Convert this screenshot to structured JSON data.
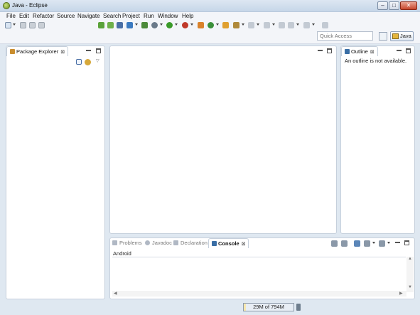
{
  "window": {
    "title": "Java - Eclipse",
    "controls": [
      "–",
      "□",
      "✕"
    ]
  },
  "menu": [
    "File",
    "Edit",
    "Refactor",
    "Source",
    "Navigate",
    "Search",
    "Project",
    "Run",
    "Window",
    "Help"
  ],
  "quick_access": {
    "placeholder": "Quick Access"
  },
  "perspective": {
    "label": "Java"
  },
  "package_explorer": {
    "title": "Package Explorer",
    "close": "⊠"
  },
  "outline": {
    "title": "Outline",
    "close": "⊠",
    "message": "An outline is not available."
  },
  "bottom_tabs": [
    {
      "label": "Problems"
    },
    {
      "label": "Javadoc"
    },
    {
      "label": "Declaration"
    },
    {
      "label": "Console",
      "active": true,
      "close": "⊠"
    }
  ],
  "console": {
    "text": "Android"
  },
  "status": {
    "heap": "29M of 794M"
  },
  "colors": {
    "workspace_bg": "#dfe8f1",
    "accent_blue": "#3a6ea5",
    "run_green": "#3a9a2a"
  }
}
